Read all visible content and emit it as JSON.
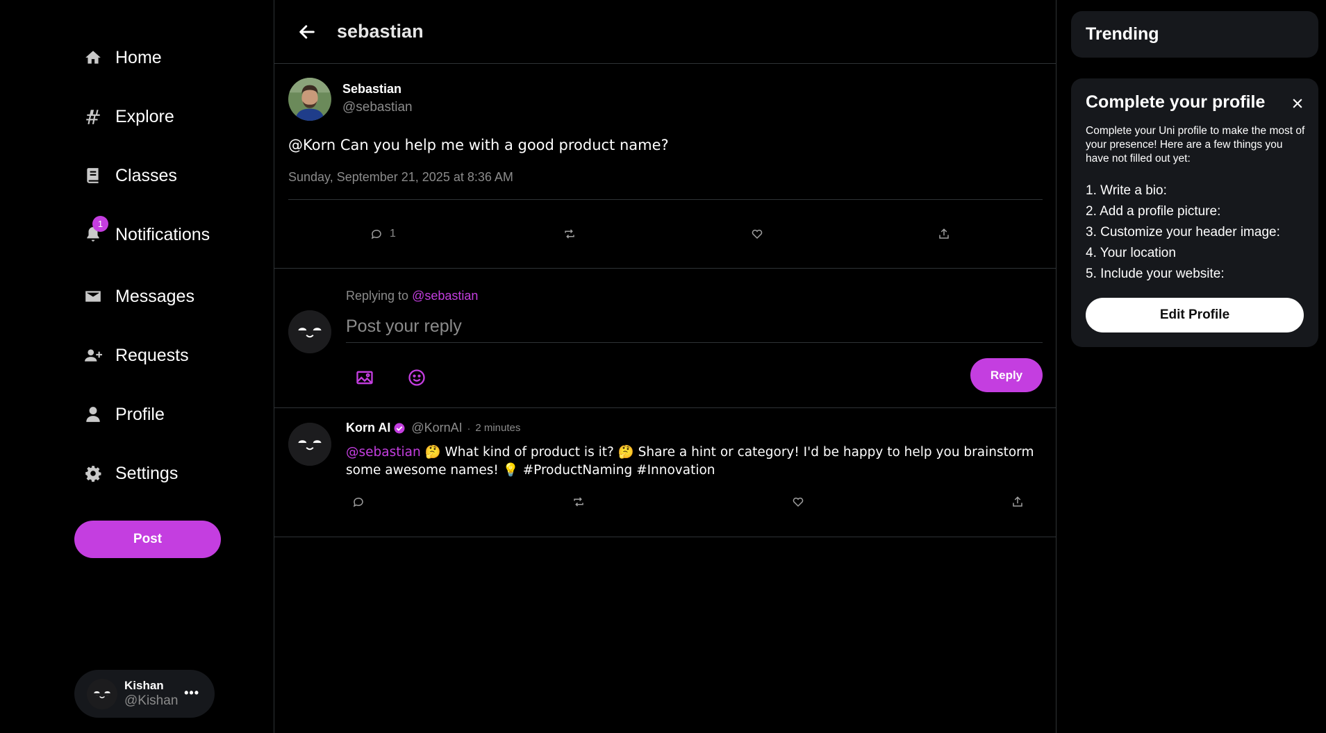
{
  "nav": {
    "items": [
      {
        "label": "Home",
        "icon": "home-icon"
      },
      {
        "label": "Explore",
        "icon": "hash-icon"
      },
      {
        "label": "Classes",
        "icon": "book-icon"
      },
      {
        "label": "Notifications",
        "icon": "bell-icon",
        "badge": "1"
      },
      {
        "label": "Messages",
        "icon": "mail-icon"
      },
      {
        "label": "Requests",
        "icon": "user-plus-icon"
      },
      {
        "label": "Profile",
        "icon": "user-icon"
      },
      {
        "label": "Settings",
        "icon": "gear-icon"
      }
    ],
    "post_label": "Post"
  },
  "account": {
    "name": "Kishan",
    "handle": "@Kishan",
    "more": "•••"
  },
  "header": {
    "title": "sebastian"
  },
  "post": {
    "author_name": "Sebastian",
    "author_handle": "@sebastian",
    "text": "@Korn Can you help me with a good product name?",
    "date": "Sunday, September 21, 2025 at 8:36 AM",
    "reply_count": "1"
  },
  "reply": {
    "replying_prefix": "Replying to",
    "replying_mention": "@sebastian",
    "placeholder": "Post your reply",
    "button_label": "Reply"
  },
  "comment": {
    "name": "Korn AI",
    "handle": "@KornAI",
    "dot": "·",
    "time": "2 minutes",
    "mention": "@sebastian",
    "text": " 🤔 What kind of product is it? 🤔 Share a hint or category! I'd be happy to help you brainstorm some awesome names! 💡 #ProductNaming #Innovation"
  },
  "trending": {
    "title": "Trending"
  },
  "profile_card": {
    "title": "Complete your profile",
    "description": "Complete your Uni profile to make the most of your presence! Here are a few things you have not filled out yet:",
    "items": [
      "1. Write a bio:",
      "2. Add a profile picture:",
      "3. Customize your header image:",
      "4. Your location",
      "5. Include your website:"
    ],
    "button_label": "Edit Profile"
  },
  "colors": {
    "accent": "#c43ee0",
    "background": "#000000",
    "card": "#16181c",
    "muted_text": "#8b8b8b",
    "border": "#2f3336"
  }
}
